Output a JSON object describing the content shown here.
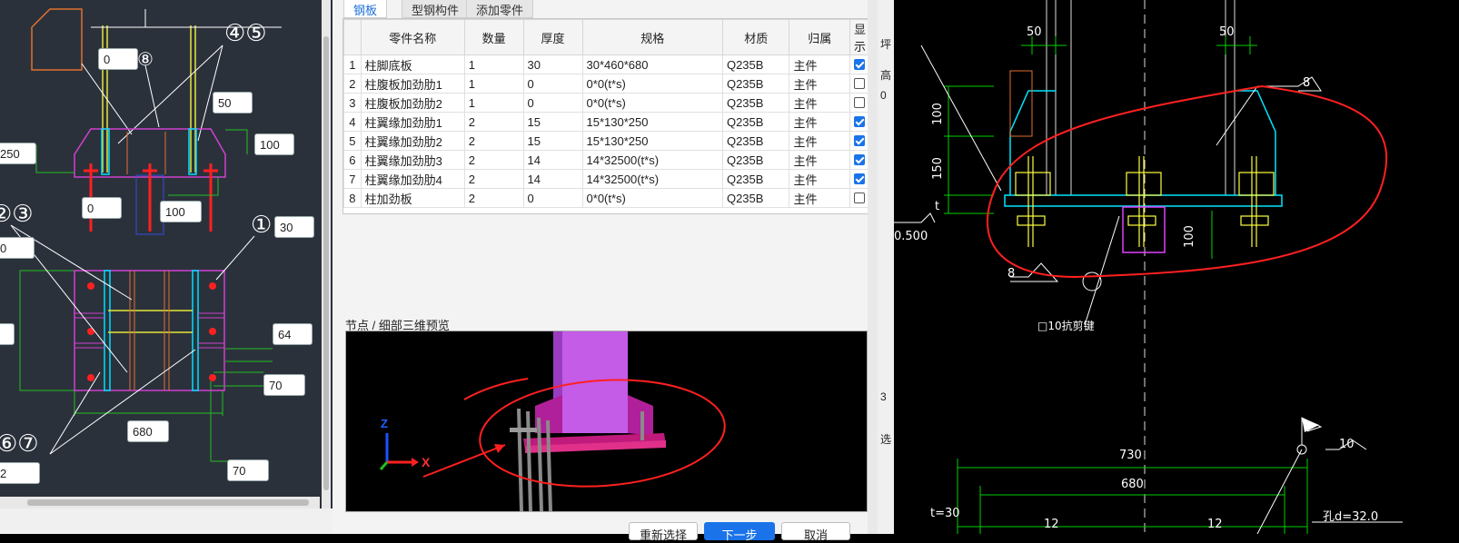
{
  "left_cad": {
    "dims": [
      "0",
      "50",
      "250",
      "100",
      "0",
      "100",
      "30",
      "0",
      "64",
      "70",
      "680",
      "2",
      "70"
    ],
    "circle_labels": [
      "④⑤",
      "⑧",
      "②③",
      "①",
      "⑥⑦"
    ]
  },
  "tabs": [
    "钢板",
    "型钢构件",
    "添加零件"
  ],
  "table": {
    "headers": [
      "",
      "零件名称",
      "数量",
      "厚度",
      "规格",
      "材质",
      "归属",
      "显示"
    ],
    "rows": [
      {
        "no": "1",
        "name": "柱脚底板",
        "qty": "1",
        "thk": "30",
        "spec": "30*460*680",
        "mat": "Q235B",
        "owner": "主件",
        "show": true
      },
      {
        "no": "2",
        "name": "柱腹板加劲肋1",
        "qty": "1",
        "thk": "0",
        "spec": "0*0(t*s)",
        "mat": "Q235B",
        "owner": "主件",
        "show": false
      },
      {
        "no": "3",
        "name": "柱腹板加劲肋2",
        "qty": "1",
        "thk": "0",
        "spec": "0*0(t*s)",
        "mat": "Q235B",
        "owner": "主件",
        "show": false
      },
      {
        "no": "4",
        "name": "柱翼缘加劲肋1",
        "qty": "2",
        "thk": "15",
        "spec": "15*130*250",
        "mat": "Q235B",
        "owner": "主件",
        "show": true
      },
      {
        "no": "5",
        "name": "柱翼缘加劲肋2",
        "qty": "2",
        "thk": "15",
        "spec": "15*130*250",
        "mat": "Q235B",
        "owner": "主件",
        "show": true
      },
      {
        "no": "6",
        "name": "柱翼缘加劲肋3",
        "qty": "2",
        "thk": "14",
        "spec": "14*32500(t*s)",
        "mat": "Q235B",
        "owner": "主件",
        "show": true
      },
      {
        "no": "7",
        "name": "柱翼缘加劲肋4",
        "qty": "2",
        "thk": "14",
        "spec": "14*32500(t*s)",
        "mat": "Q235B",
        "owner": "主件",
        "show": true
      },
      {
        "no": "8",
        "name": "柱加劲板",
        "qty": "2",
        "thk": "0",
        "spec": "0*0(t*s)",
        "mat": "Q235B",
        "owner": "主件",
        "show": false
      }
    ]
  },
  "preview": {
    "title": "节点 / 细部三维预览",
    "axis_z": "Z",
    "axis_x": "X"
  },
  "buttons": {
    "reselect": "重新选择",
    "next": "下一步",
    "cancel": "取消"
  },
  "right_cad": {
    "dims_top": [
      "50",
      "50",
      "8",
      "100",
      "150",
      "t",
      "100",
      "8",
      "10"
    ],
    "label_left": "坪",
    "label_left2": "高",
    "label_zero": "0",
    "elev": "0.500",
    "anchor_label": "□10抗剪键",
    "dims_bottom": [
      "730",
      "680",
      "12",
      "12",
      "t=30",
      "孔d=32.0"
    ],
    "side_chars": [
      "3",
      "选"
    ]
  },
  "colors": {
    "accent": "#1a73e8",
    "cad_green": "#00d000",
    "cad_cyan": "#00e5ff",
    "cad_yellow": "#ffff40",
    "cad_magenta": "#e040fb",
    "annotation_red": "#ff2020"
  }
}
